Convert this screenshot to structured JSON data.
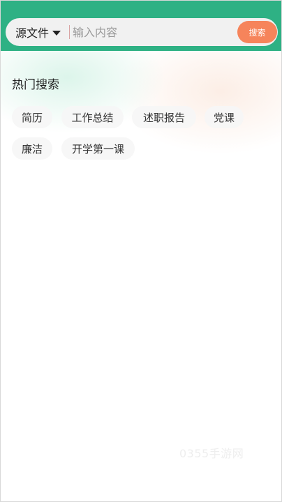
{
  "header": {
    "scope_label": "源文件",
    "search_placeholder": "输入内容",
    "search_value": "",
    "search_button_label": "搜索"
  },
  "hot_search": {
    "title": "热门搜索",
    "tags": [
      "简历",
      "工作总结",
      "述职报告",
      "党课",
      "廉洁",
      "开学第一课"
    ]
  },
  "watermark": "0355手游网",
  "colors": {
    "header_green": "#2eb184",
    "search_button_orange": "#f6845b",
    "search_box_bg": "#f1f1f1"
  }
}
